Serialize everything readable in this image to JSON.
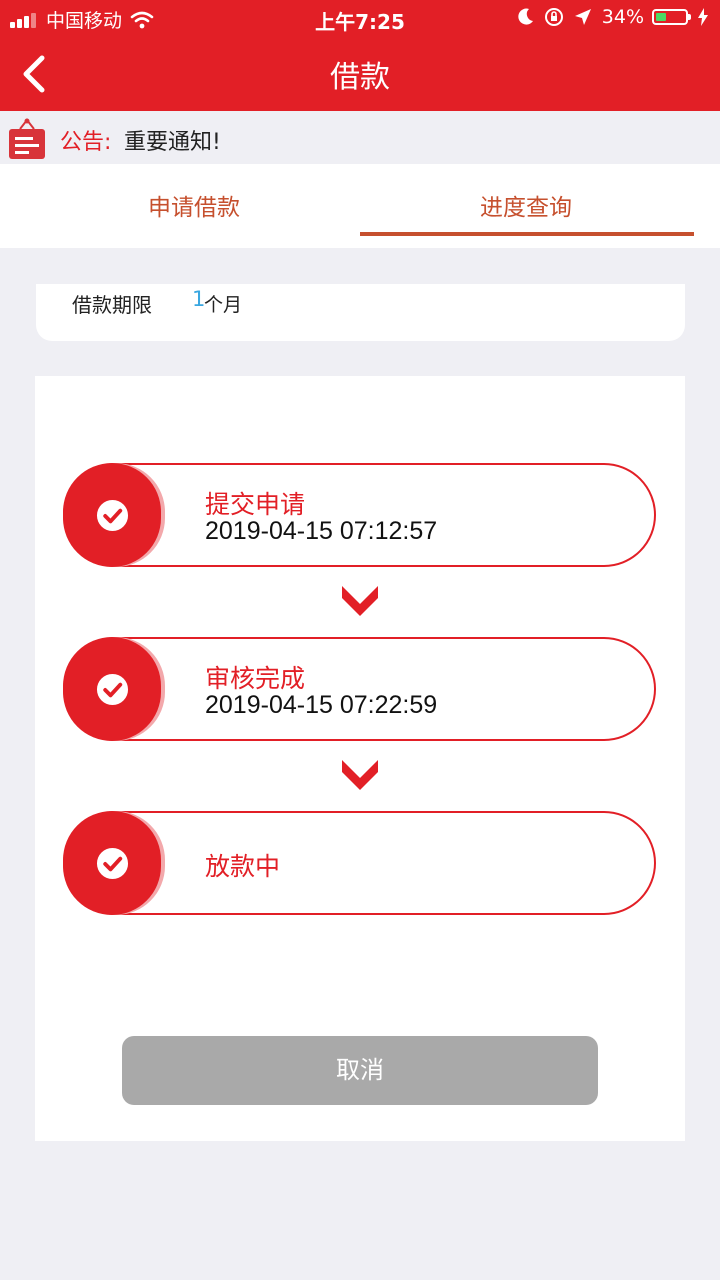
{
  "status_bar": {
    "carrier": "中国移动",
    "time": "上午7:25",
    "battery_percent": "34%",
    "battery_level": 0.34
  },
  "nav": {
    "title": "借款"
  },
  "notice": {
    "label": "公告:",
    "text": "重要通知!"
  },
  "tabs": [
    {
      "label": "申请借款",
      "active": false
    },
    {
      "label": "进度查询",
      "active": true
    }
  ],
  "loan": {
    "term_label": "借款期限",
    "term_value": "1",
    "term_unit": "个月"
  },
  "steps": [
    {
      "title": "提交申请",
      "time": "2019-04-15 07:12:57"
    },
    {
      "title": "审核完成",
      "time": "2019-04-15 07:22:59"
    },
    {
      "title": "放款中",
      "time": ""
    }
  ],
  "actions": {
    "cancel_label": "取消"
  },
  "colors": {
    "brand_red": "#e21f26",
    "tab_accent": "#c6502e",
    "disabled_gray": "#a9a9a9",
    "link_blue": "#3aa7e0"
  }
}
